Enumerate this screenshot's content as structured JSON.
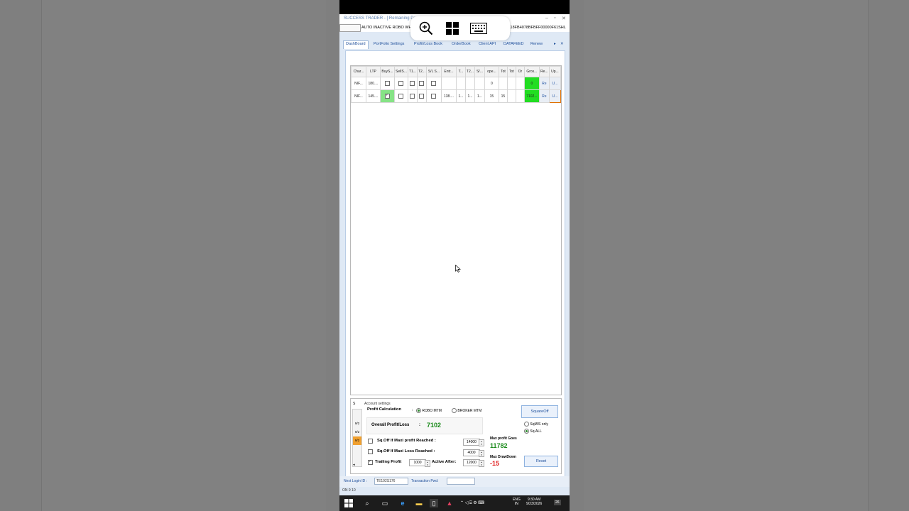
{
  "window": {
    "title": "SUCCESS TRADER - [ Remaining Day",
    "status_message": "AUTO INACTIVE ROBO WH",
    "license_key": "/PSC6118FB4078BFBFF00000F61SHL"
  },
  "overlay_icons": [
    "zoom-icon",
    "windows-logo-icon",
    "keyboard-icon"
  ],
  "tabs": [
    {
      "label": "DashBoard",
      "active": true
    },
    {
      "label": "PortFolio Settings"
    },
    {
      "label": "Profit/Loss Book"
    },
    {
      "label": "OrderBook"
    },
    {
      "label": "Client API"
    },
    {
      "label": "DATAFEED"
    },
    {
      "label": "Renew"
    }
  ],
  "grid": {
    "headers": [
      "Char...",
      "LTP",
      "BuyS...",
      "SellS...",
      "T1...",
      "T2...",
      "S/L S...",
      "Entr...",
      "T...",
      "T2...",
      "S/...",
      "ope...",
      "Tot",
      "Tot",
      "Or",
      "Gros...",
      "Re...",
      "Up..."
    ],
    "rows": [
      {
        "symbol": "NIF...",
        "ltp": "180....",
        "buy": false,
        "sell": false,
        "t1": false,
        "t2": false,
        "sl": false,
        "entry": "",
        "t": "",
        "t2v": "",
        "s": "",
        "open": "0",
        "tot1": "",
        "tot2": "",
        "or": "",
        "gross": "0",
        "re": "Re",
        "up": "U..."
      },
      {
        "symbol": "NIF...",
        "ltp": "145....",
        "buy": true,
        "sell": false,
        "t1": false,
        "t2": false,
        "sl": false,
        "entry": "138....",
        "t": "1...",
        "t2v": "1...",
        "s": "1...",
        "open": "15",
        "tot1": "15",
        "tot2": "",
        "or": "",
        "gross": "7102...",
        "re": "Re",
        "up": "U..."
      }
    ]
  },
  "account": {
    "section_title": "Account settings",
    "dates": [
      "9/2",
      "9/2",
      "9/2"
    ],
    "list_header": "S",
    "profit_calc_label": "Profit Calculation",
    "robo_mtm": "ROBO MTM",
    "broker_mtm": "BROKER MTM",
    "overall_label": "Overall Profit/Loss",
    "overall_value": "7102",
    "maxi_profit_label": "Sq.Off If Maxi profit Reached :",
    "maxi_profit_value": "14000",
    "maxi_loss_label": "Sq.Off If Maxi Loss Reached :",
    "maxi_loss_value": "4000",
    "trailing_label": "Trailing Profit",
    "trailing_value": "1000",
    "active_after_label": "Active After:",
    "active_after_value": "12000",
    "max_profit_goes_label": "Max profit Goes",
    "max_profit_goes_value": "11782",
    "max_drawdown_label": "Max DrawDown",
    "max_drawdown_value": "-15",
    "squareoff_button": "SquareOff",
    "sqmis_label": "SqMIS only",
    "sqall_label": "Sq.ALL",
    "reset_button": "Reset",
    "colors": {
      "profit": "#1a8a1a",
      "loss": "#e02020"
    }
  },
  "footer": {
    "next_login_label": "Next Login ID :",
    "next_login_value": "TE192S176",
    "txn_pwd_label": "Transaction Pwd:",
    "version": "ON 9 10"
  },
  "taskbar": {
    "lang": "ENG",
    "region": "IN",
    "time": "9:30 AM",
    "date": "9/23/2026",
    "notif_count": "26"
  }
}
